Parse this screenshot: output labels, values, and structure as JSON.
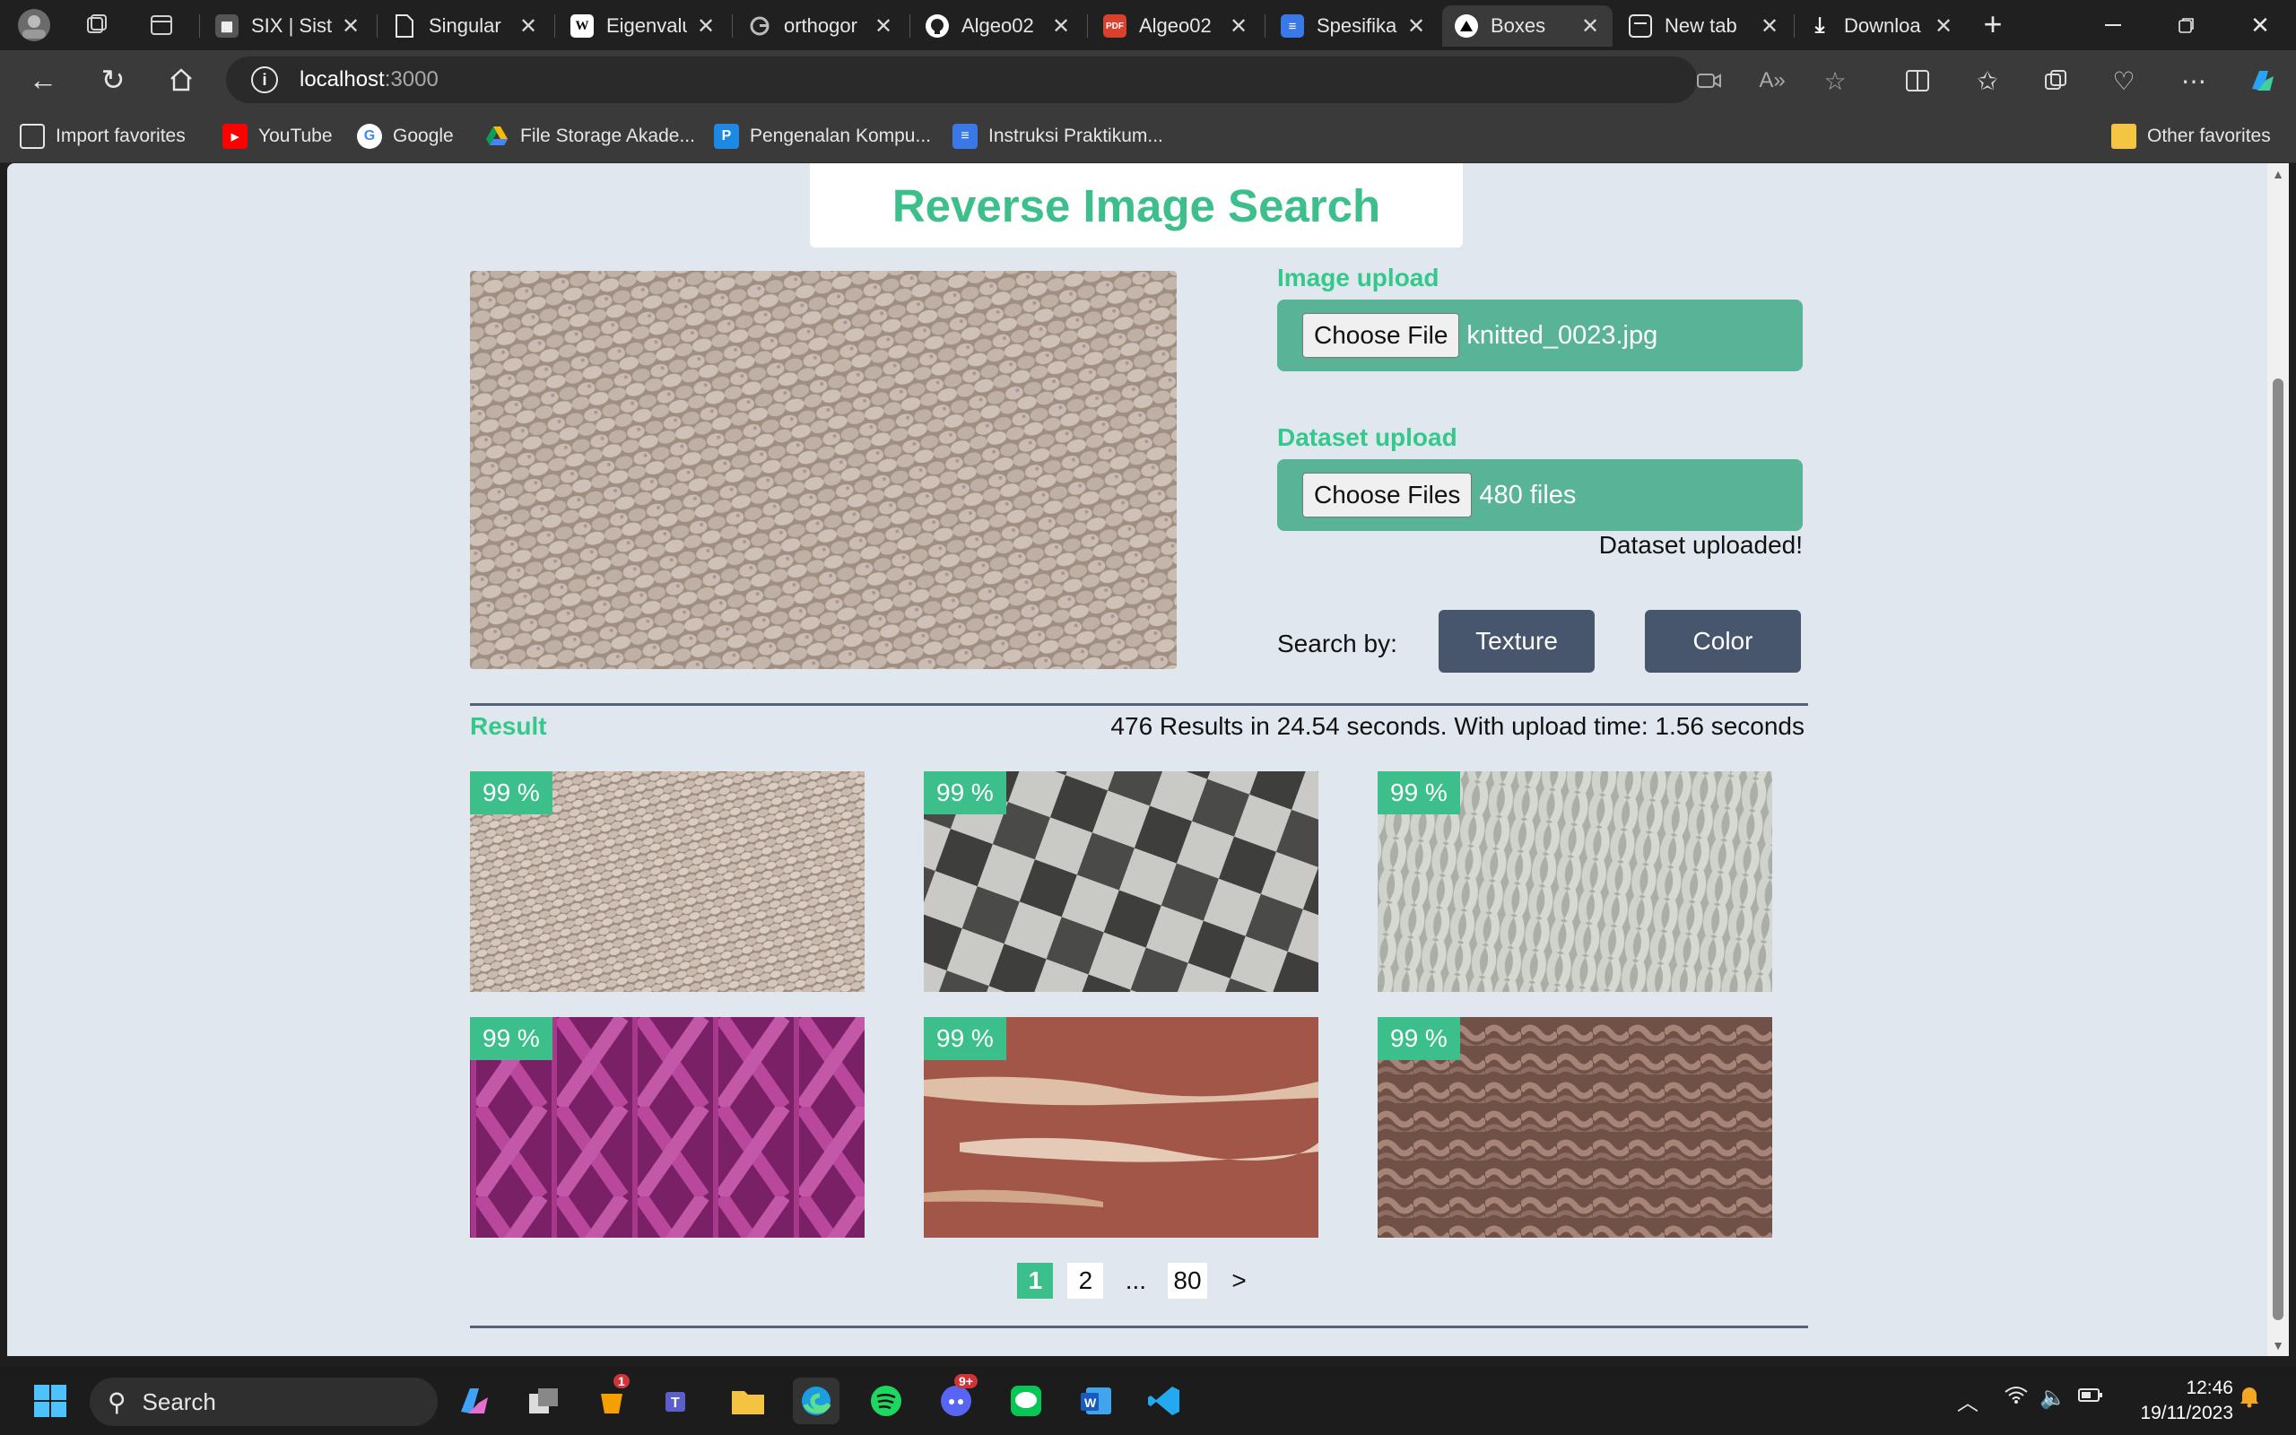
{
  "browser": {
    "tabs": [
      {
        "title": "SIX | Siste",
        "favicon": "six-logo"
      },
      {
        "title": "Singular",
        "favicon": "document-icon"
      },
      {
        "title": "Eigenvalu",
        "favicon": "wikipedia-icon"
      },
      {
        "title": "orthogor",
        "favicon": "google-icon"
      },
      {
        "title": "Algeo02",
        "favicon": "github-icon"
      },
      {
        "title": "Algeo02",
        "favicon": "pdf-icon"
      },
      {
        "title": "Spesifika",
        "favicon": "docs-icon"
      },
      {
        "title": "Boxes",
        "favicon": "triangle-icon",
        "active": true
      },
      {
        "title": "New tab",
        "favicon": "newtab-icon"
      },
      {
        "title": "Downloa",
        "favicon": "download-icon"
      }
    ],
    "url_host": "localhost",
    "url_port": ":3000",
    "favorites": [
      {
        "label": "Import favorites"
      },
      {
        "label": "YouTube"
      },
      {
        "label": "Google"
      },
      {
        "label": "File Storage Akade..."
      },
      {
        "label": "Pengenalan Kompu..."
      },
      {
        "label": "Instruksi Praktikum..."
      }
    ],
    "other_favorites": "Other favorites"
  },
  "page": {
    "title": "Reverse Image Search",
    "image_upload": {
      "label": "Image upload",
      "button": "Choose File",
      "file_name": "knitted_0023.jpg"
    },
    "dataset_upload": {
      "label": "Dataset upload",
      "button": "Choose Files",
      "file_count": "480 files",
      "status": "Dataset uploaded!"
    },
    "search_by": {
      "label": "Search by:",
      "options": [
        "Texture",
        "Color"
      ]
    },
    "result": {
      "label": "Result",
      "stats": "476 Results in 24.54 seconds. With upload time: 1.56 seconds",
      "items": [
        {
          "similarity": "99 %",
          "texture": "knitted-beige"
        },
        {
          "similarity": "99 %",
          "texture": "checkerboard"
        },
        {
          "similarity": "99 %",
          "texture": "knitted-grey"
        },
        {
          "similarity": "99 %",
          "texture": "knitted-magenta"
        },
        {
          "similarity": "99 %",
          "texture": "peeling-paint"
        },
        {
          "similarity": "99 %",
          "texture": "ruffled-brown"
        }
      ]
    },
    "pagination": {
      "current": "1",
      "next_page": "2",
      "ellipsis": "...",
      "last": "80",
      "next": ">"
    }
  },
  "taskbar": {
    "search_label": "Search",
    "time": "12:46",
    "date": "19/11/2023",
    "badges": {
      "app1": "1",
      "discord": "9+"
    }
  },
  "colors": {
    "accent_green": "#3dbf8c",
    "upload_box": "#59b396",
    "button_slate": "#47566d",
    "page_bg": "#e0e7ef"
  }
}
